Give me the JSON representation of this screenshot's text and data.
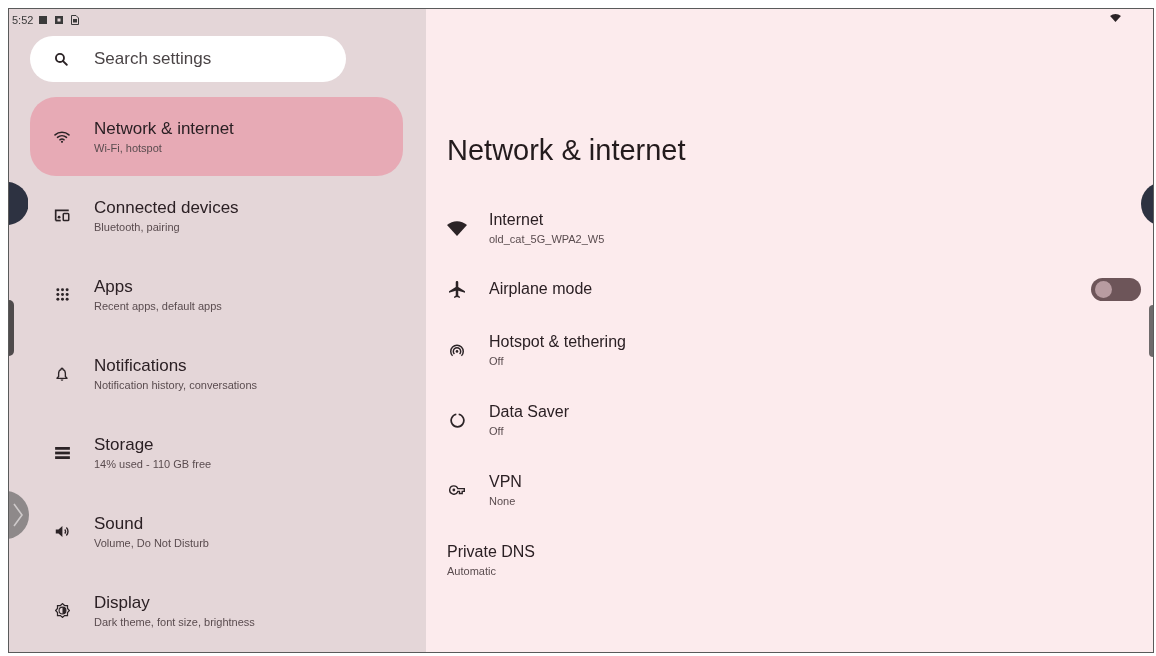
{
  "status_bar": {
    "time": "5:52"
  },
  "search": {
    "placeholder": "Search settings"
  },
  "sidebar": {
    "items": [
      {
        "title": "Network & internet",
        "subtitle": "Wi-Fi, hotspot",
        "selected": true
      },
      {
        "title": "Connected devices",
        "subtitle": "Bluetooth, pairing",
        "selected": false
      },
      {
        "title": "Apps",
        "subtitle": "Recent apps, default apps",
        "selected": false
      },
      {
        "title": "Notifications",
        "subtitle": "Notification history, conversations",
        "selected": false
      },
      {
        "title": "Storage",
        "subtitle": "14% used - 110 GB free",
        "selected": false
      },
      {
        "title": "Sound",
        "subtitle": "Volume, Do Not Disturb",
        "selected": false
      },
      {
        "title": "Display",
        "subtitle": "Dark theme, font size, brightness",
        "selected": false
      }
    ]
  },
  "page": {
    "title": "Network & internet",
    "items": [
      {
        "kind": "link",
        "title": "Internet",
        "subtitle": "old_cat_5G_WPA2_W5"
      },
      {
        "kind": "toggle",
        "title": "Airplane mode",
        "on": false
      },
      {
        "kind": "link",
        "title": "Hotspot & tethering",
        "subtitle": "Off"
      },
      {
        "kind": "link",
        "title": "Data Saver",
        "subtitle": "Off"
      },
      {
        "kind": "link",
        "title": "VPN",
        "subtitle": "None"
      },
      {
        "kind": "link",
        "title": "Private DNS",
        "subtitle": "Automatic"
      }
    ]
  }
}
